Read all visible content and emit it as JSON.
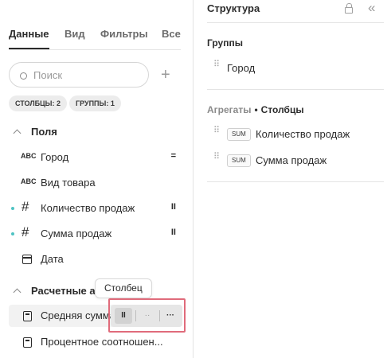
{
  "tabs": [
    "Данные",
    "Вид",
    "Фильтры",
    "Все"
  ],
  "search": {
    "placeholder": "Поиск"
  },
  "add_icon": "plus-icon",
  "chips": {
    "columns": "СТОЛБЦЫ: 2",
    "groups": "ГРУППЫ: 1"
  },
  "fields_section": {
    "title": "Поля"
  },
  "fields": [
    {
      "type_label": "ABC",
      "label": "Город",
      "indicator": "="
    },
    {
      "type_label": "ABC",
      "label": "Вид товара",
      "indicator": ""
    },
    {
      "type_label": "#",
      "label": "Количество продаж",
      "indicator": "II"
    },
    {
      "type_label": "#",
      "label": "Сумма продаж",
      "indicator": "II"
    },
    {
      "type_label": "calendar-icon",
      "label": "Дата",
      "indicator": ""
    }
  ],
  "calc_section": {
    "title": "Расчетные ат"
  },
  "calc_fields": [
    {
      "icon": "calculator-icon",
      "label": "Средняя сумма"
    },
    {
      "icon": "calculator-icon",
      "label": "Процентное соотношен..."
    }
  ],
  "tooltip": "Столбец",
  "hover_actions": {
    "column": "II",
    "group": "··",
    "more": "···"
  },
  "accent_colors": {
    "measure_dot": "#4fc3c3",
    "highlight_box": "#e06b7b"
  },
  "structure": {
    "title": "Структура",
    "groups_title": "Группы",
    "groups": [
      "Город"
    ],
    "aggregates_title": "Агрегаты",
    "aggregates_subtitle": "Столбцы",
    "aggregates": [
      {
        "func": "SUM",
        "label": "Количество продаж"
      },
      {
        "func": "SUM",
        "label": "Сумма продаж"
      }
    ]
  }
}
